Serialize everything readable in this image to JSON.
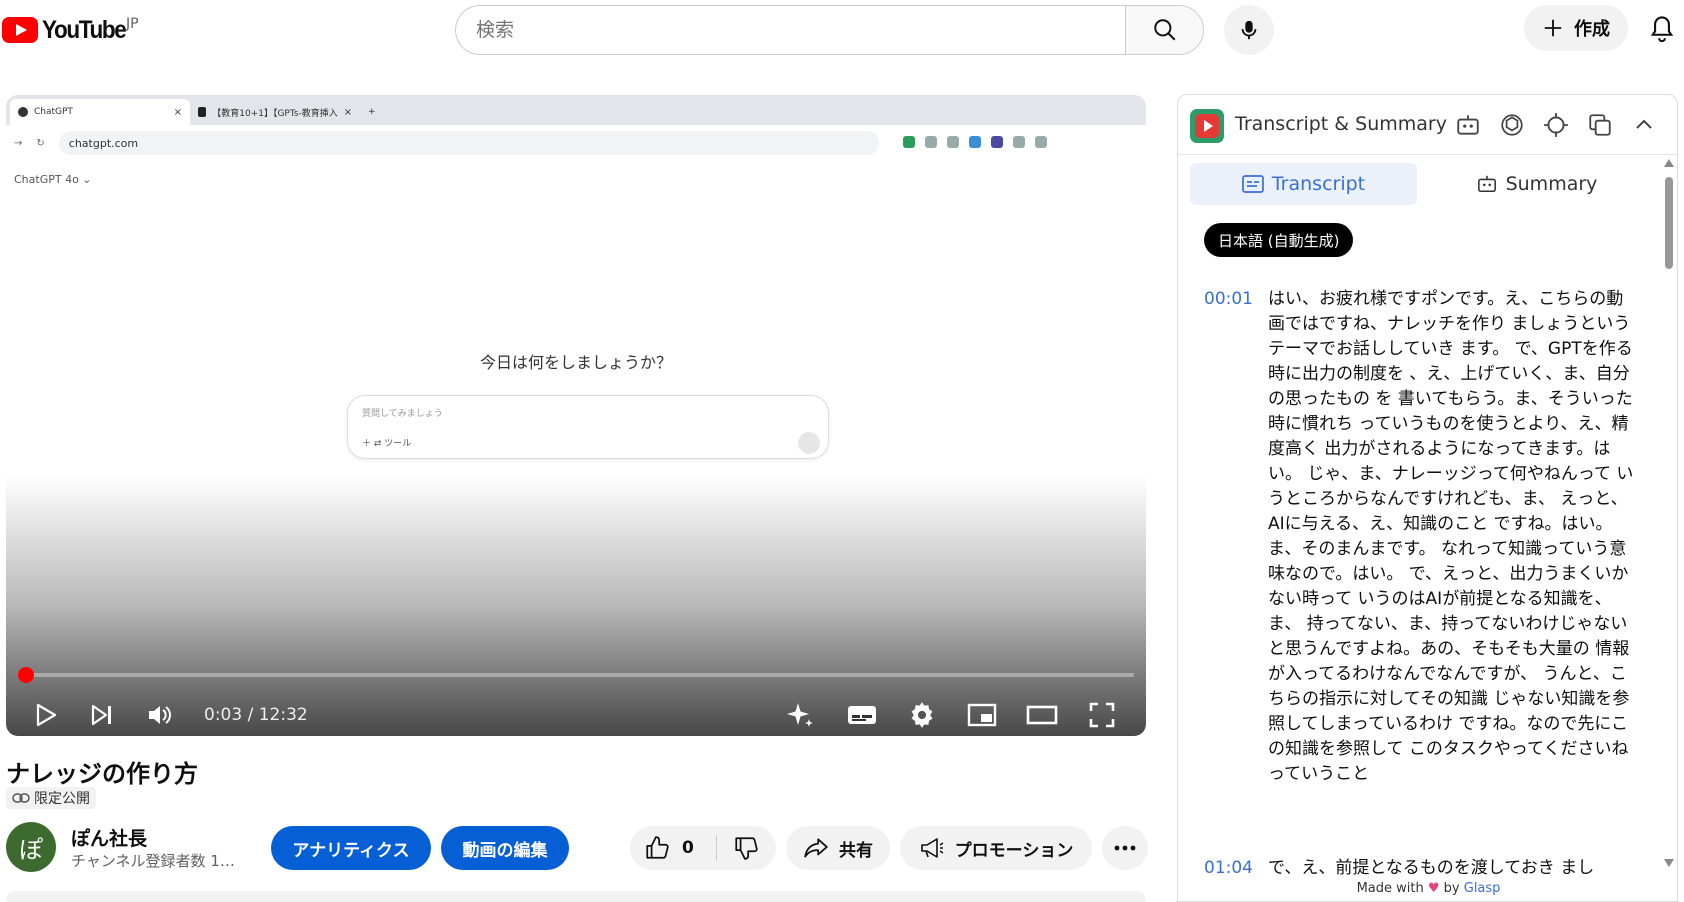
{
  "header": {
    "logo_text": "YouTube",
    "country_code": "JP",
    "search_placeholder": "検索",
    "create_label": "作成"
  },
  "player": {
    "browser_tabs": [
      {
        "label": "ChatGPT",
        "close": "×"
      },
      {
        "label": "【教育10+1】【GPTs-教育挿入くん…",
        "close": "×"
      }
    ],
    "new_tab": "+",
    "url": "chatgpt.com",
    "chat_model": "ChatGPT 4o ⌄",
    "chat_question": "今日は何をしましょうか？",
    "chat_placeholder": "質問してみましょう",
    "chat_tools": "＋  ⇄ ツール",
    "time_display": "0:03 / 12:32",
    "progress_fraction": 0.004
  },
  "video": {
    "title": "ナレッジの作り方",
    "visibility": "限定公開",
    "channel_initial": "ぽ",
    "channel_name": "ぽん社長",
    "subscribers": "チャンネル登録者数 1…",
    "analytics_label": "アナリティクス",
    "edit_label": "動画の編集",
    "like_count": "0",
    "share_label": "共有",
    "promotion_label": "プロモーション"
  },
  "transcript_panel": {
    "title": "Transcript & Summary",
    "tab_transcript": "Transcript",
    "tab_summary": "Summary",
    "language": "日本語 (自動生成)",
    "segments": [
      {
        "time": "00:01",
        "text": "はい、お疲れ様ですポンです。え、こちらの動画ではですね、ナレッチを作り ましょうというテーマでお話ししていき ます。 で、GPTを作る時に出力の制度を 、え、上げていく、ま、自分の思ったもの を 書いてもらう。ま、そういった時に慣れち っていうものを使うとより、え、精度高く 出力がされるようになってきます。はい。 じゃ、ま、ナレーッジって何やねんって いうところからなんですけれども、ま、 えっと、AIに与える、え、知識のこと ですね。はい。ま、そのまんまです。 なれって知識っていう意味なので。はい。 で、えっと、出力うまくいかない時って いうのはAIが前提となる知識を、ま、 持ってない、ま、持ってないわけじゃない と思うんですよね。あの、そもそも大量の 情報が入ってるわけなんでなんですが、 うんと、こちらの指示に対してその知識 じゃない知識を参照してしまっているわけ ですね。なので先にこの知識を参照して このタスクやってくださいねっていうこと"
      },
      {
        "time": "01:04",
        "text": "で、え、前提となるものを渡しておき まし"
      }
    ],
    "footer_made_with": "Made with",
    "footer_by": "by",
    "footer_brand": "Glasp"
  }
}
